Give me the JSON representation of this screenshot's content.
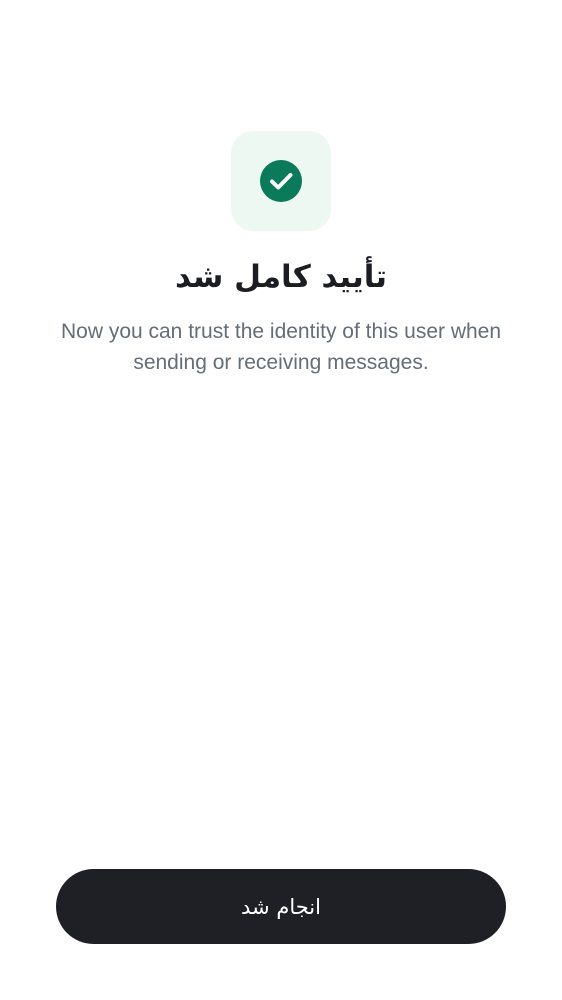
{
  "header": {
    "icon": "check-circle-icon",
    "title": "تأیید کامل شد",
    "subtitle": "Now you can trust the identity of this user when sending or receiving messages."
  },
  "footer": {
    "done_label": "انجام شد"
  },
  "colors": {
    "accent": "#0b7a5a",
    "icon_tile_bg": "#eef8f3",
    "title": "#1b1d22",
    "subtitle": "#656d77",
    "button_bg": "#1f2026",
    "button_text": "#ffffff",
    "background": "#ffffff"
  }
}
